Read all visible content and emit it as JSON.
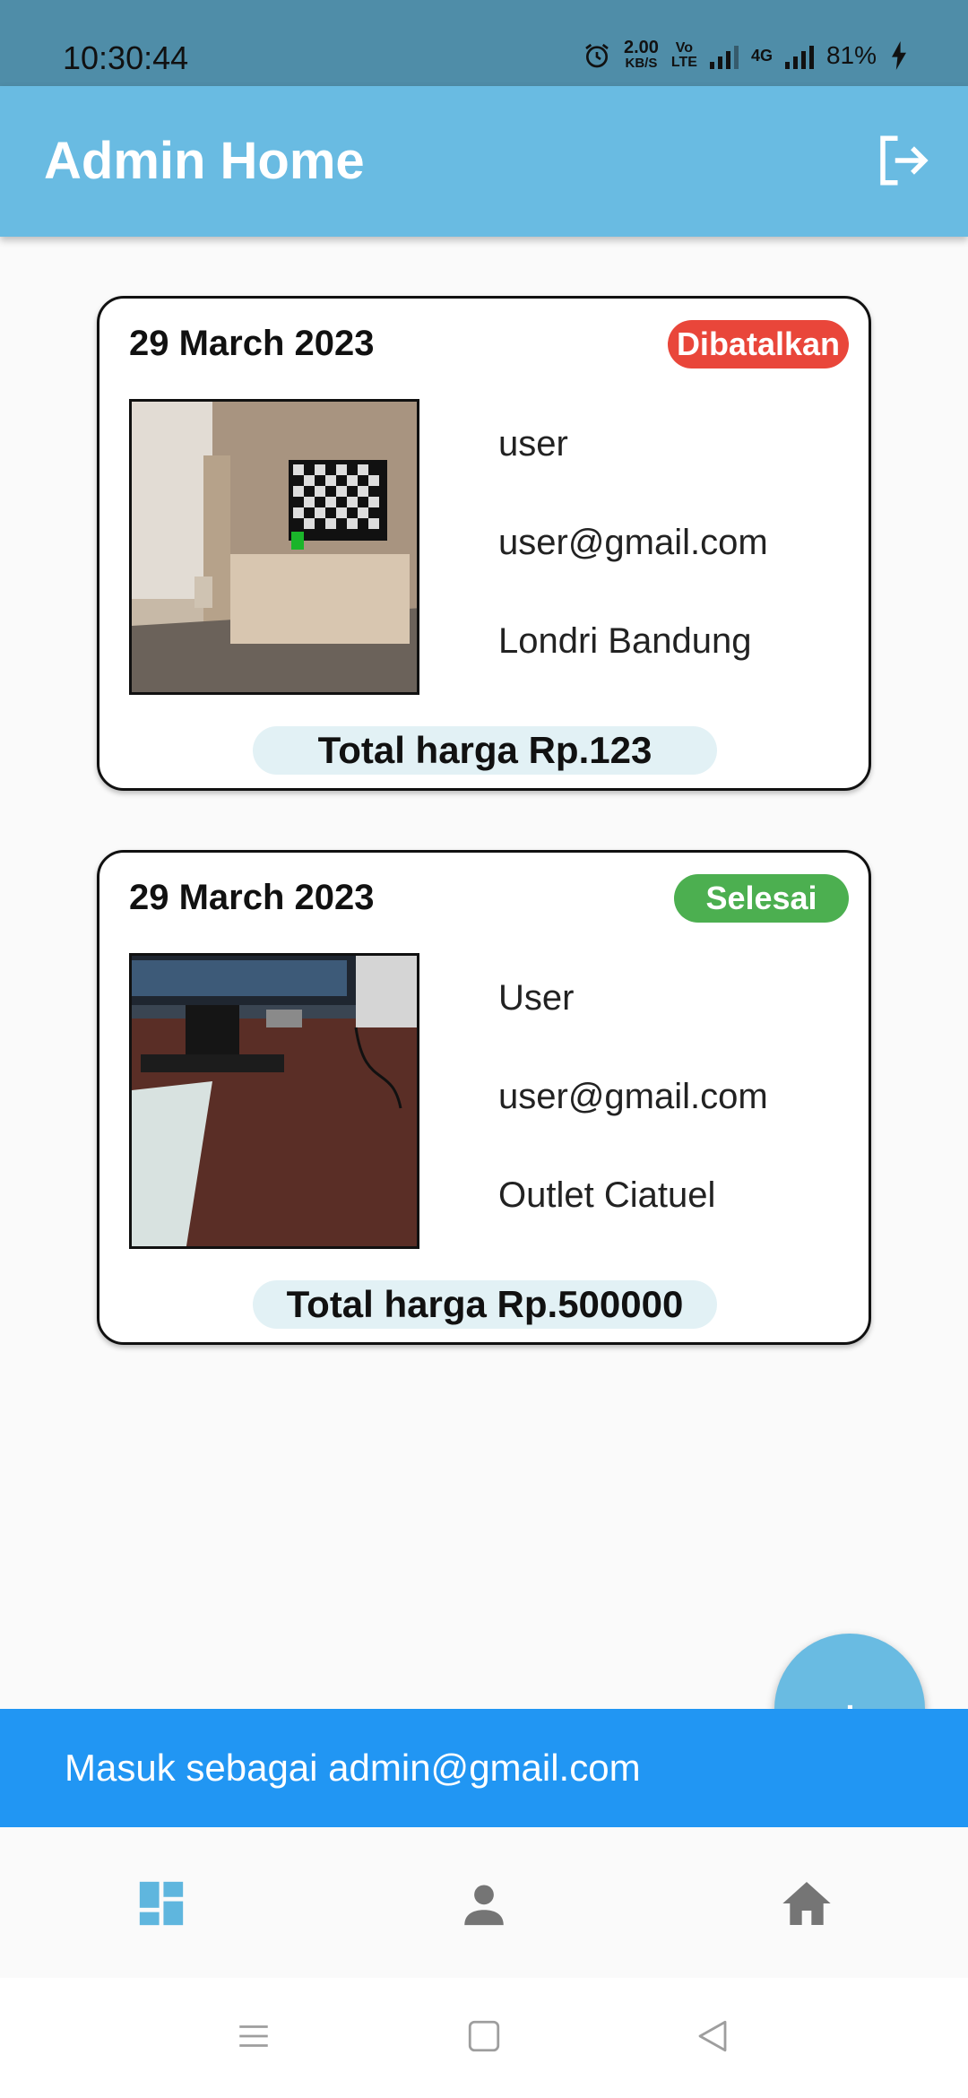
{
  "status_bar": {
    "time": "10:30:44",
    "net_speed_value": "2.00",
    "net_speed_unit": "KB/S",
    "volte_top": "Vo",
    "volte_bottom": "LTE",
    "network": "4G",
    "battery": "81%"
  },
  "app_bar": {
    "title": "Admin Home",
    "logout_icon": "logout-icon",
    "bg_color": "#69bbe2"
  },
  "orders": [
    {
      "date": "29 March 2023",
      "status": "Dibatalkan",
      "status_color": "#e9463a",
      "name": "user",
      "email": "user@gmail.com",
      "outlet": "Londri Bandung",
      "total": "Total harga Rp.123"
    },
    {
      "date": "29 March 2023",
      "status": "Selesai",
      "status_color": "#4caf50",
      "name": "User",
      "email": "user@gmail.com",
      "outlet": "Outlet Ciatuel",
      "total": "Total harga Rp.500000"
    }
  ],
  "fab": {
    "label": "+",
    "icon": "add-icon"
  },
  "snackbar": {
    "text": "Masuk sebagai admin@gmail.com",
    "bg_color": "#2196f3"
  },
  "bottom_nav": [
    {
      "icon": "dashboard-icon",
      "active": true
    },
    {
      "icon": "person-icon",
      "active": false
    },
    {
      "icon": "home-icon",
      "active": false
    }
  ],
  "system_nav": [
    "menu-icon",
    "square-icon",
    "back-triangle-icon"
  ]
}
